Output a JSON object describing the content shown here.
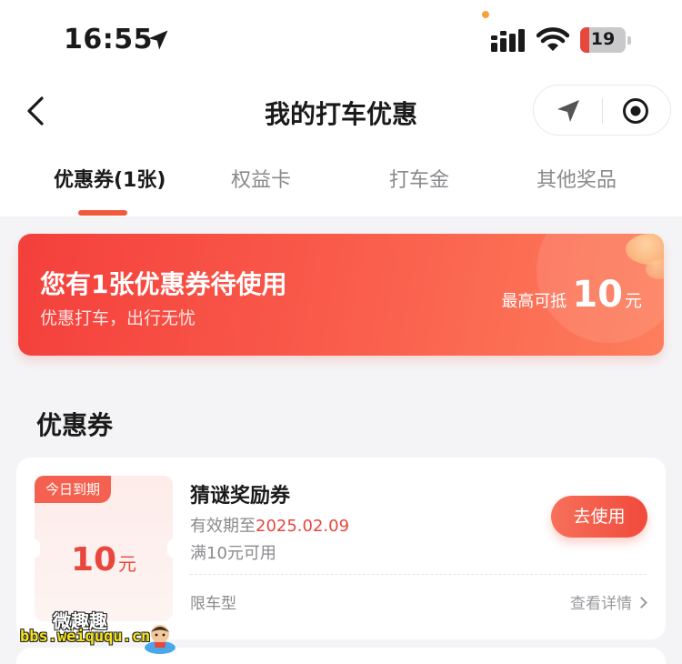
{
  "status_bar": {
    "time": "16:55",
    "battery": "19",
    "battery_level": 0.19
  },
  "nav": {
    "title": "我的打车优惠"
  },
  "tabs": [
    {
      "label": "优惠券(1张)",
      "active": true
    },
    {
      "label": "权益卡",
      "active": false
    },
    {
      "label": "打车金",
      "active": false
    },
    {
      "label": "其他奖品",
      "active": false
    }
  ],
  "banner": {
    "title": "您有1张优惠券待使用",
    "subtitle": "优惠打车，出行无忧",
    "max_label": "最高可抵",
    "max_amount": "10",
    "max_unit": "元"
  },
  "section": {
    "title": "优惠券"
  },
  "coupon": {
    "badge": "今日到期",
    "amount": "10",
    "unit": "元",
    "name": "猜谜奖励券",
    "valid_prefix": "有效期至",
    "valid_date": "2025.02.09",
    "min_spend": "满10元可用",
    "use_label": "去使用",
    "car_limit": "限车型",
    "details_label": "查看详情"
  },
  "watermark": {
    "name": "微趣趣",
    "url": "bbs.weiququ.cn"
  },
  "colors": {
    "accent": "#f05a3a",
    "price": "#e8473d",
    "banner_start": "#f43f3b",
    "banner_end": "#fd7e5c"
  }
}
